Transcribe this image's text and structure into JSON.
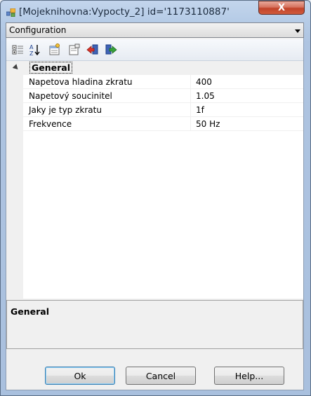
{
  "window": {
    "title": "[Mojeknihovna:Vypocty_2] id='1173110887'",
    "close_glyph": "X",
    "app_icon": "window-app-icon"
  },
  "selector": {
    "value": "Configuration"
  },
  "toolbar": {
    "icons": [
      "categorized-icon",
      "alphabetical-sort-icon",
      "property-pages-icon",
      "properties-icon",
      "import-icon",
      "export-icon"
    ]
  },
  "grid": {
    "category": "General",
    "rows": [
      {
        "name": "Napetova hladina zkratu",
        "value": "400"
      },
      {
        "name": "Napetový soucinitel",
        "value": "1.05"
      },
      {
        "name": "Jaky je typ zkratu",
        "value": "1f"
      },
      {
        "name": "Frekvence",
        "value": "50 Hz"
      }
    ]
  },
  "description": {
    "title": "General"
  },
  "buttons": {
    "ok": "Ok",
    "cancel": "Cancel",
    "help": "Help..."
  },
  "colors": {
    "title_bg": "#b5cbe6",
    "close_bg": "#c1432a",
    "grid_bg": "#ffffff",
    "panel_bg": "#f0f0f0"
  }
}
